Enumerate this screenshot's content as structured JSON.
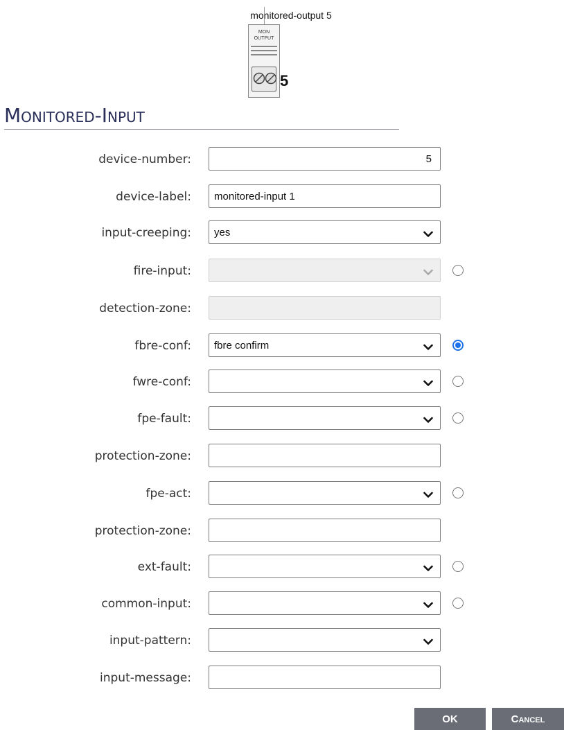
{
  "device": {
    "title": "monitored-output 5",
    "icon_label": "MON\nOUTPUT",
    "number": "5",
    "icon_name": "terminal-block-icon"
  },
  "section": {
    "title": "Monitored-Input"
  },
  "fields": [
    {
      "label": "device-number:",
      "type": "text",
      "value": "5",
      "align": "right"
    },
    {
      "label": "device-label:",
      "type": "text",
      "value": "monitored-input 1"
    },
    {
      "label": "input-creeping:",
      "type": "select",
      "value": "yes"
    },
    {
      "label": "fire-input:",
      "type": "select",
      "value": "",
      "disabled": true,
      "radio": "unchecked"
    },
    {
      "label": "detection-zone:",
      "type": "text",
      "value": "",
      "disabled": true
    },
    {
      "label": "fbre-conf:",
      "type": "select",
      "value": "fbre confirm",
      "radio": "checked"
    },
    {
      "label": "fwre-conf:",
      "type": "select",
      "value": "",
      "radio": "unchecked"
    },
    {
      "label": "fpe-fault:",
      "type": "select",
      "value": "",
      "radio": "unchecked"
    },
    {
      "label": "protection-zone:",
      "type": "text",
      "value": ""
    },
    {
      "label": "fpe-act:",
      "type": "select",
      "value": "",
      "radio": "unchecked"
    },
    {
      "label": "protection-zone:",
      "type": "text",
      "value": ""
    },
    {
      "label": "ext-fault:",
      "type": "select",
      "value": "",
      "radio": "unchecked"
    },
    {
      "label": "common-input:",
      "type": "select",
      "value": "",
      "radio": "unchecked"
    },
    {
      "label": "input-pattern:",
      "type": "select",
      "value": ""
    },
    {
      "label": "input-message:",
      "type": "text",
      "value": ""
    }
  ],
  "buttons": {
    "ok": "OK",
    "cancel": "Cancel"
  },
  "colors": {
    "accent": "#1a73e8",
    "title": "#2a2f5a",
    "button": "#6a6c76"
  }
}
